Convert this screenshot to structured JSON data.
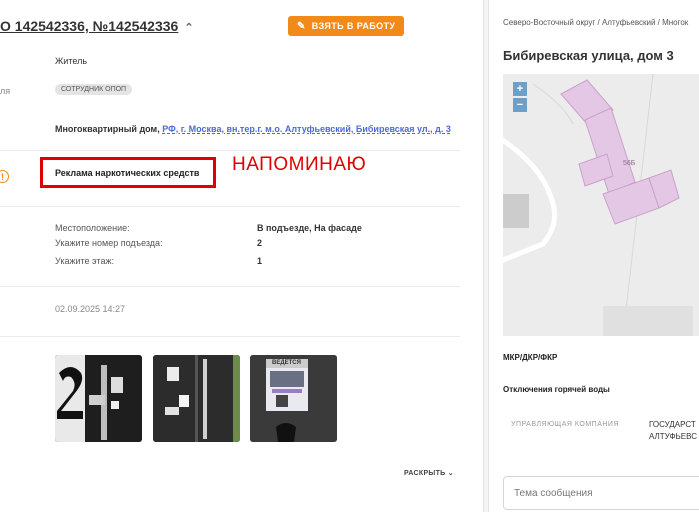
{
  "request": {
    "title": "О 142542336, №142542336",
    "take_button": "ВЗЯТЬ В РАБОТУ",
    "resident": "Житель",
    "side_label_fragment": "ля",
    "role_chip": "СОТРУДНИК ОПОП",
    "building_type": "Многоквартирный дом,",
    "address_link": "РФ, г. Москва, вн.тер.г. м.о. Алтуфьевский, Бибиревская ул., д. 3",
    "category": "Реклама наркотических средств",
    "reminder": "НАПОМИНАЮ",
    "details": [
      {
        "label": "Местоположение:",
        "value": "В подъезде, На фасаде"
      },
      {
        "label": "Укажите номер подъезда:",
        "value": "2"
      },
      {
        "label": "Укажите этаж:",
        "value": "1"
      }
    ],
    "date": "02.09.2025 14:27",
    "expand_label": "РАСКРЫТЬ",
    "photo_poster_text": "ВЕДЕТСЯ"
  },
  "panel": {
    "breadcrumb": "Северо-Восточный округ / Алтуфьевский / Многок",
    "address": "Бибиревская улица, дом 3",
    "map_building_label": "56Б",
    "mkr_label": "МКР/ДКР/ФКР",
    "hot_water_label": "Отключения горячей воды",
    "mgmt_company_label": "УПРАВЛЯЮЩАЯ КОМПАНИЯ",
    "mgmt_company_value_1": "ГОСУДАРСТ",
    "mgmt_company_value_2": "АЛТУФЬЕВС",
    "message_placeholder": "Тема сообщения"
  },
  "colors": {
    "accent": "#f28a1a",
    "highlight": "#e00000",
    "link": "#4a6bd6"
  },
  "icons": [
    "pencil-icon",
    "chevron-up-icon",
    "warning-icon",
    "chevron-down-icon",
    "zoom-in-icon",
    "zoom-out-icon"
  ]
}
